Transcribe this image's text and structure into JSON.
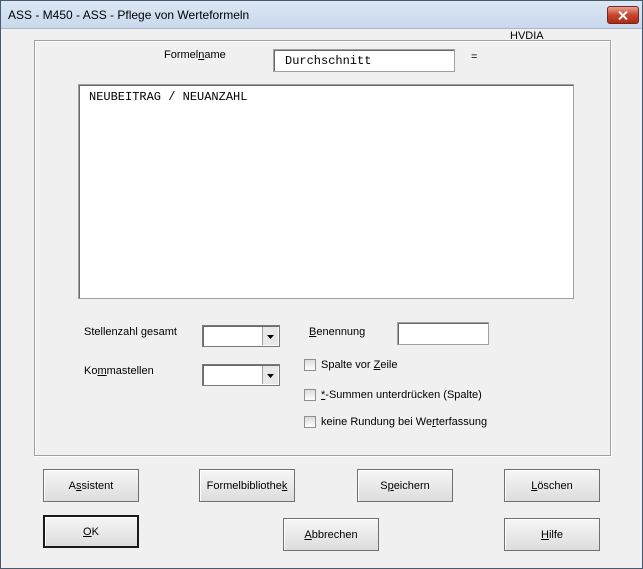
{
  "window": {
    "title": "ASS - M450 - ASS - Pflege von Werteformeln",
    "close_icon": "close-icon"
  },
  "header": {
    "tag": "HVDIA"
  },
  "formelname": {
    "label_pre": "Formel",
    "label_hot": "n",
    "label_post": "ame",
    "value": "Durchschnitt",
    "equals": "="
  },
  "formula": {
    "text": "NEUBEITRAG / NEUANZAHL"
  },
  "stellenzahl": {
    "label_pre": "Stellenzahl ",
    "label_hot": "g",
    "label_post": "esamt",
    "selected": ""
  },
  "kommastellen": {
    "label_pre": "Ko",
    "label_hot": "m",
    "label_post": "mastellen",
    "selected": ""
  },
  "benennung": {
    "label_pre": "",
    "label_hot": "B",
    "label_post": "enennung",
    "value": ""
  },
  "checkboxes": [
    {
      "pre": "Spalte vor ",
      "hot": "Z",
      "post": "eile",
      "checked": false
    },
    {
      "pre": "",
      "hot": "*",
      "post": "-Summen unterdrücken (Spalte)",
      "checked": false
    },
    {
      "pre": "keine Rundung bei We",
      "hot": "r",
      "post": "terfassung",
      "checked": false
    }
  ],
  "buttons": {
    "assistent": {
      "pre": "A",
      "hot": "s",
      "post": "sistent"
    },
    "formelbibliothek": {
      "pre": "Formelbibliothe",
      "hot": "k",
      "post": ""
    },
    "speichern": {
      "pre": "S",
      "hot": "p",
      "post": "eichern"
    },
    "loeschen": {
      "pre": "",
      "hot": "L",
      "post": "öschen"
    },
    "ok": {
      "pre": "",
      "hot": "O",
      "post": "K"
    },
    "abbrechen": {
      "pre": "",
      "hot": "A",
      "post": "bbrechen"
    },
    "hilfe": {
      "pre": "",
      "hot": "H",
      "post": "ilfe"
    }
  }
}
